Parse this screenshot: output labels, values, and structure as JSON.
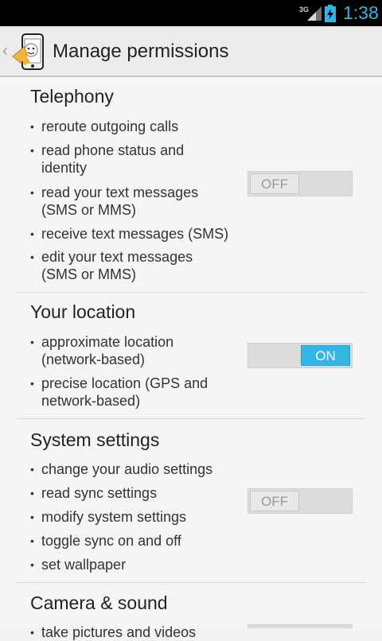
{
  "status_bar": {
    "network": "3G",
    "time": "1:38"
  },
  "action_bar": {
    "title": "Manage permissions"
  },
  "groups": [
    {
      "title": "Telephony",
      "items": [
        "reroute outgoing calls",
        "read phone status and identity",
        "read your text messages (SMS or MMS)",
        "receive text messages (SMS)",
        "edit your text messages (SMS or MMS)"
      ],
      "toggle": "OFF"
    },
    {
      "title": "Your location",
      "items": [
        "approximate location (network-based)",
        "precise location (GPS and network-based)"
      ],
      "toggle": "ON"
    },
    {
      "title": "System settings",
      "items": [
        "change your audio settings",
        "read sync settings",
        "modify system settings",
        "toggle sync on and off",
        "set wallpaper"
      ],
      "toggle": "OFF"
    },
    {
      "title": "Camera & sound",
      "items": [
        "take pictures and videos"
      ],
      "toggle": ""
    }
  ],
  "colors": {
    "accent": "#33b5e5",
    "status_bar": "#000000",
    "background": "#f5f5f5"
  }
}
